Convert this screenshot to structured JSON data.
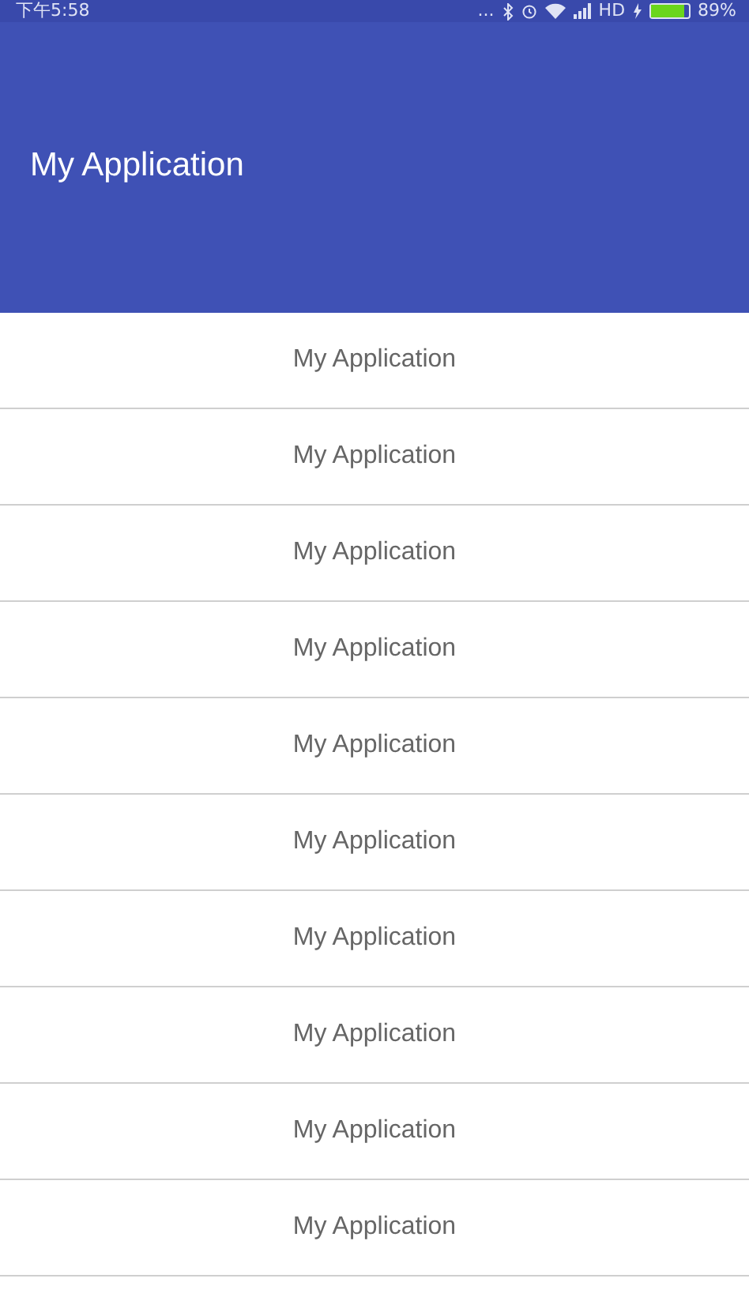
{
  "status_bar": {
    "time": "下午5:58",
    "more": "...",
    "network": "HD",
    "battery": {
      "level": 0.89
    },
    "battery_text": "89%"
  },
  "app_bar": {
    "title": "My Application"
  },
  "list": [
    {
      "label": "My Application"
    },
    {
      "label": "My Application"
    },
    {
      "label": "My Application"
    },
    {
      "label": "My Application"
    },
    {
      "label": "My Application"
    },
    {
      "label": "My Application"
    },
    {
      "label": "My Application"
    },
    {
      "label": "My Application"
    },
    {
      "label": "My Application"
    },
    {
      "label": "My Application"
    }
  ]
}
